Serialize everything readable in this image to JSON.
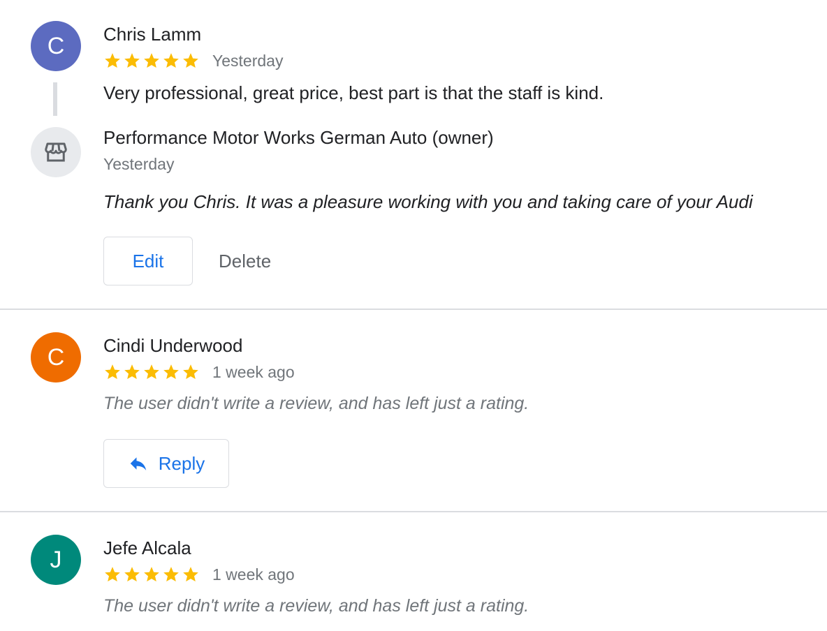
{
  "reviews": [
    {
      "initial": "C",
      "avatar_color": "#5c6bc0",
      "name": "Chris Lamm",
      "rating": 5,
      "date": "Yesterday",
      "text": "Very professional, great price, best part is that the staff is kind.",
      "owner_response": {
        "name": "Performance Motor Works German Auto (owner)",
        "date": "Yesterday",
        "text": "Thank you Chris. It was a pleasure working with you and taking care of your Audi"
      },
      "actions": {
        "edit_label": "Edit",
        "delete_label": "Delete"
      }
    },
    {
      "initial": "C",
      "avatar_color": "#ef6c00",
      "name": "Cindi Underwood",
      "rating": 5,
      "date": "1 week ago",
      "text": "The user didn't write a review, and has left just a rating.",
      "actions": {
        "reply_label": "Reply"
      }
    },
    {
      "initial": "J",
      "avatar_color": "#00897b",
      "name": "Jefe Alcala",
      "rating": 5,
      "date": "1 week ago",
      "text": "The user didn't write a review, and has left just a rating."
    }
  ],
  "colors": {
    "star": "#fbbc04",
    "link_blue": "#1a73e8",
    "muted_text": "#70757a",
    "divider": "#dadce0"
  },
  "icons": {
    "star": "star-icon",
    "store": "storefront-icon",
    "reply": "reply-arrow-icon"
  }
}
